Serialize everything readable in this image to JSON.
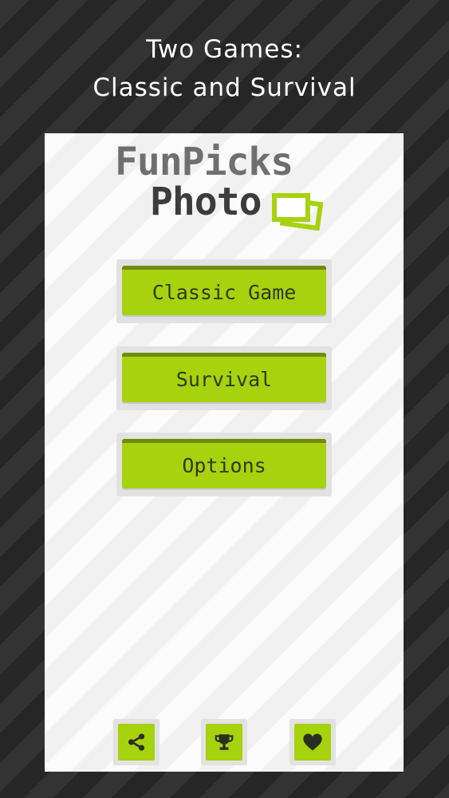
{
  "headline": {
    "line1": "Two Games:",
    "line2": "Classic and Survival"
  },
  "logo": {
    "line1": "FunPicks",
    "line2": "Photo",
    "icon": "photo-frames-icon"
  },
  "menu": {
    "buttons": [
      {
        "label": "Classic Game"
      },
      {
        "label": "Survival"
      },
      {
        "label": "Options"
      }
    ]
  },
  "toolbar": {
    "icons": [
      "share-icon",
      "trophy-icon",
      "heart-icon"
    ]
  },
  "colors": {
    "accent": "#a6d20e",
    "accent_dark": "#6d8c08",
    "text_dark": "#303a08",
    "background": "#2c2c2c"
  }
}
